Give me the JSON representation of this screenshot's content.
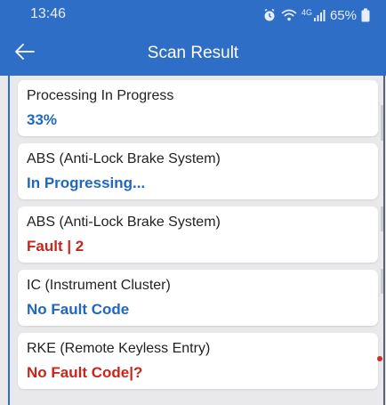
{
  "status_bar": {
    "time": "13:46",
    "network": "4G",
    "battery": "65%"
  },
  "appbar": {
    "title": "Scan Result"
  },
  "results": [
    {
      "title": "Processing In Progress",
      "status": "33%",
      "status_color": "#2067bf"
    },
    {
      "title": "ABS (Anti-Lock Brake System)",
      "status": "In Progressing...",
      "status_color": "#2067bf"
    },
    {
      "title": "ABS (Anti-Lock Brake System)",
      "status": "Fault  | 2",
      "status_color": "#c8261c"
    },
    {
      "title": "IC (Instrument Cluster)",
      "status": "No Fault Code",
      "status_color": "#2067bf"
    },
    {
      "title": "RKE (Remote Keyless Entry)",
      "status": "No Fault Code|?",
      "status_color": "#c8261c"
    }
  ],
  "colors": {
    "header": "#2f6ec7",
    "background": "#e9e9ec",
    "indicator_dot": "#d32b25"
  }
}
